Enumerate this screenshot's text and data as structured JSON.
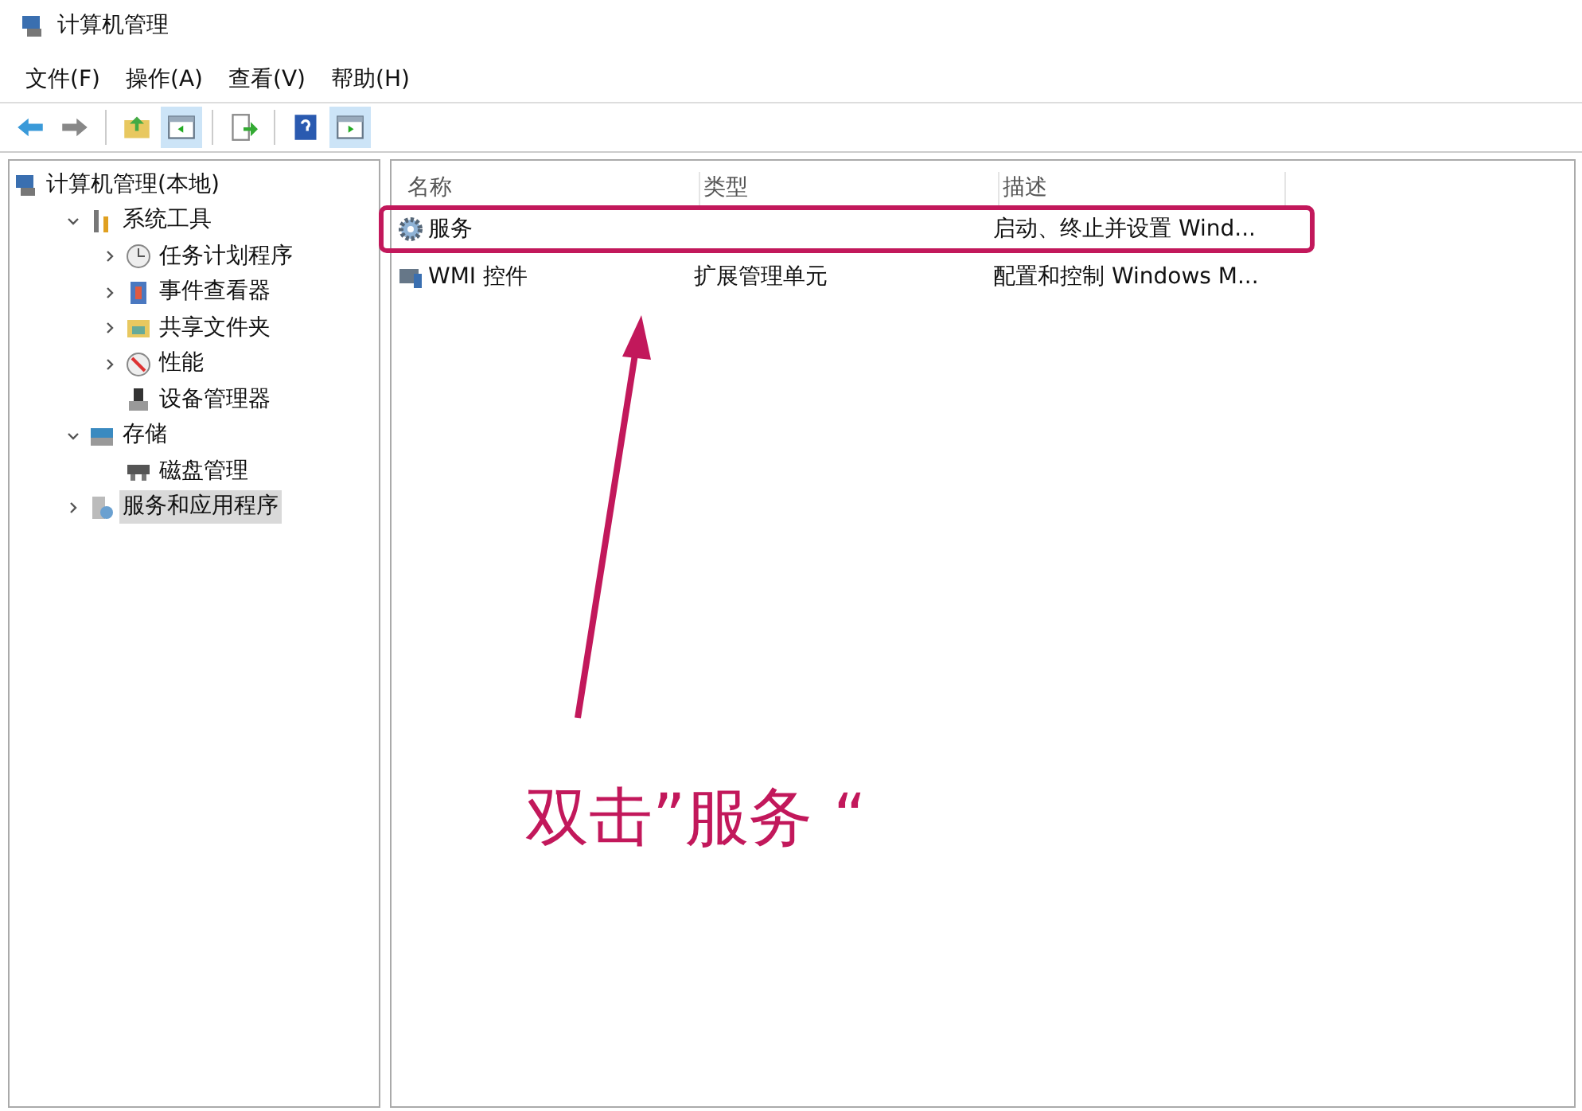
{
  "window": {
    "title": "计算机管理"
  },
  "menu": [
    "文件(F)",
    "操作(A)",
    "查看(V)",
    "帮助(H)"
  ],
  "toolbar": [
    {
      "kind": "back",
      "selected": false
    },
    {
      "kind": "forward",
      "selected": false
    },
    {
      "kind": "sep"
    },
    {
      "kind": "up",
      "selected": false
    },
    {
      "kind": "pane",
      "selected": true
    },
    {
      "kind": "sep"
    },
    {
      "kind": "export",
      "selected": false
    },
    {
      "kind": "sep"
    },
    {
      "kind": "help",
      "selected": false
    },
    {
      "kind": "action",
      "selected": true
    }
  ],
  "tree": [
    {
      "label": "计算机管理(本地)",
      "kind": "computer",
      "selected": false,
      "children": [
        {
          "label": "系统工具",
          "kind": "tools",
          "expanded": true,
          "selected": false,
          "children": [
            {
              "label": "任务计划程序",
              "kind": "clock",
              "expanded": false,
              "selected": false
            },
            {
              "label": "事件查看器",
              "kind": "log",
              "expanded": false,
              "selected": false
            },
            {
              "label": "共享文件夹",
              "kind": "folder",
              "expanded": false,
              "selected": false
            },
            {
              "label": "性能",
              "kind": "gauge",
              "expanded": false,
              "selected": false
            },
            {
              "label": "设备管理器",
              "kind": "device",
              "selected": false
            }
          ]
        },
        {
          "label": "存储",
          "kind": "storage",
          "expanded": true,
          "selected": false,
          "children": [
            {
              "label": "磁盘管理",
              "kind": "disk",
              "selected": false
            }
          ]
        },
        {
          "label": "服务和应用程序",
          "kind": "services",
          "expanded": false,
          "selected": true
        }
      ]
    }
  ],
  "table": {
    "columns": [
      "名称",
      "类型",
      "描述"
    ],
    "rows": [
      {
        "kind": "gear",
        "cells": [
          "服务",
          "",
          "启动、终止并设置 Wind..."
        ],
        "highlighted": true
      },
      {
        "kind": "wmi",
        "cells": [
          "WMI 控件",
          "扩展管理单元",
          "配置和控制 Windows M..."
        ],
        "highlighted": false
      }
    ]
  },
  "annotation": {
    "text": "双击”服务 “",
    "color": "#c2185b"
  }
}
